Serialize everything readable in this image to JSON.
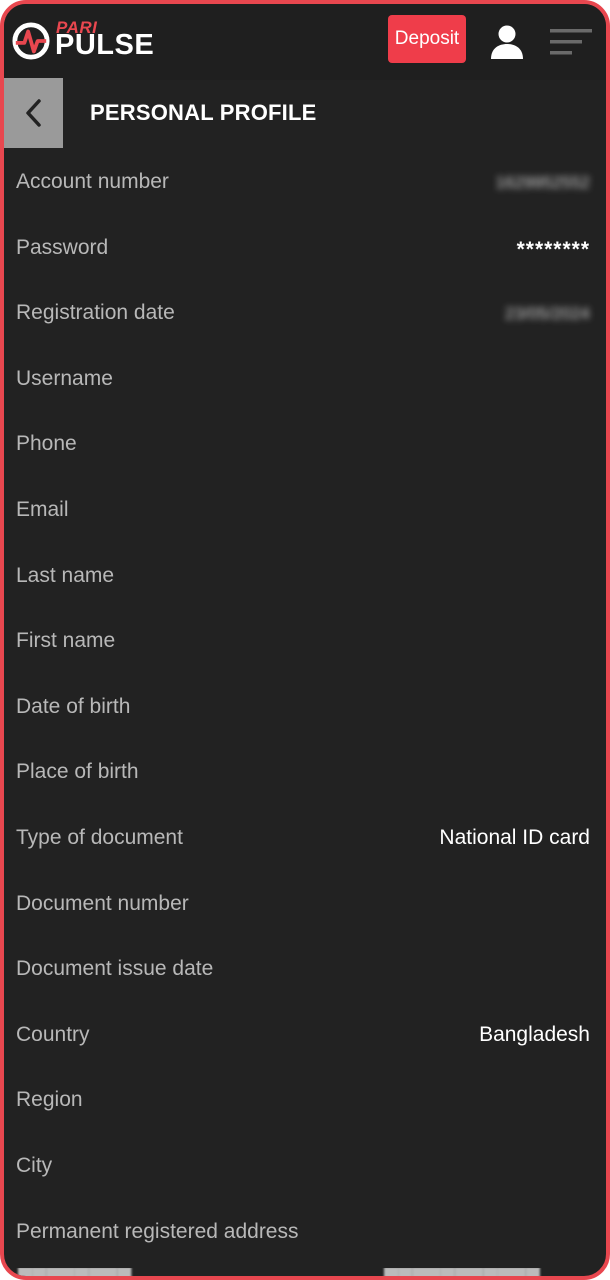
{
  "header": {
    "logo_top": "PARI",
    "logo_bottom": "PULSE",
    "deposit_label": "Deposit",
    "icons": {
      "logo": "paripulse-logo-icon",
      "user": "user-icon",
      "menu": "menu-icon"
    },
    "colors": {
      "accent": "#ef3d4a",
      "background": "#222222",
      "header": "#1f1f1f"
    }
  },
  "page": {
    "title": "PERSONAL PROFILE",
    "back_icon": "chevron-left-icon"
  },
  "profile_fields": [
    {
      "label": "Account number",
      "value": "1629952552"
    },
    {
      "label": "Password",
      "value": "********"
    },
    {
      "label": "Registration date",
      "value": "23/05/2024"
    },
    {
      "label": "Username",
      "value": ""
    },
    {
      "label": "Phone",
      "value": ""
    },
    {
      "label": "Email",
      "value": ""
    },
    {
      "label": "Last name",
      "value": ""
    },
    {
      "label": "First name",
      "value": ""
    },
    {
      "label": "Date of birth",
      "value": ""
    },
    {
      "label": "Place of birth",
      "value": ""
    },
    {
      "label": "Type of document",
      "value": "National ID card"
    },
    {
      "label": "Document number",
      "value": ""
    },
    {
      "label": "Document issue date",
      "value": ""
    },
    {
      "label": "Country",
      "value": "Bangladesh"
    },
    {
      "label": "Region",
      "value": ""
    },
    {
      "label": "City",
      "value": ""
    },
    {
      "label": "Permanent registered address",
      "value": ""
    }
  ]
}
